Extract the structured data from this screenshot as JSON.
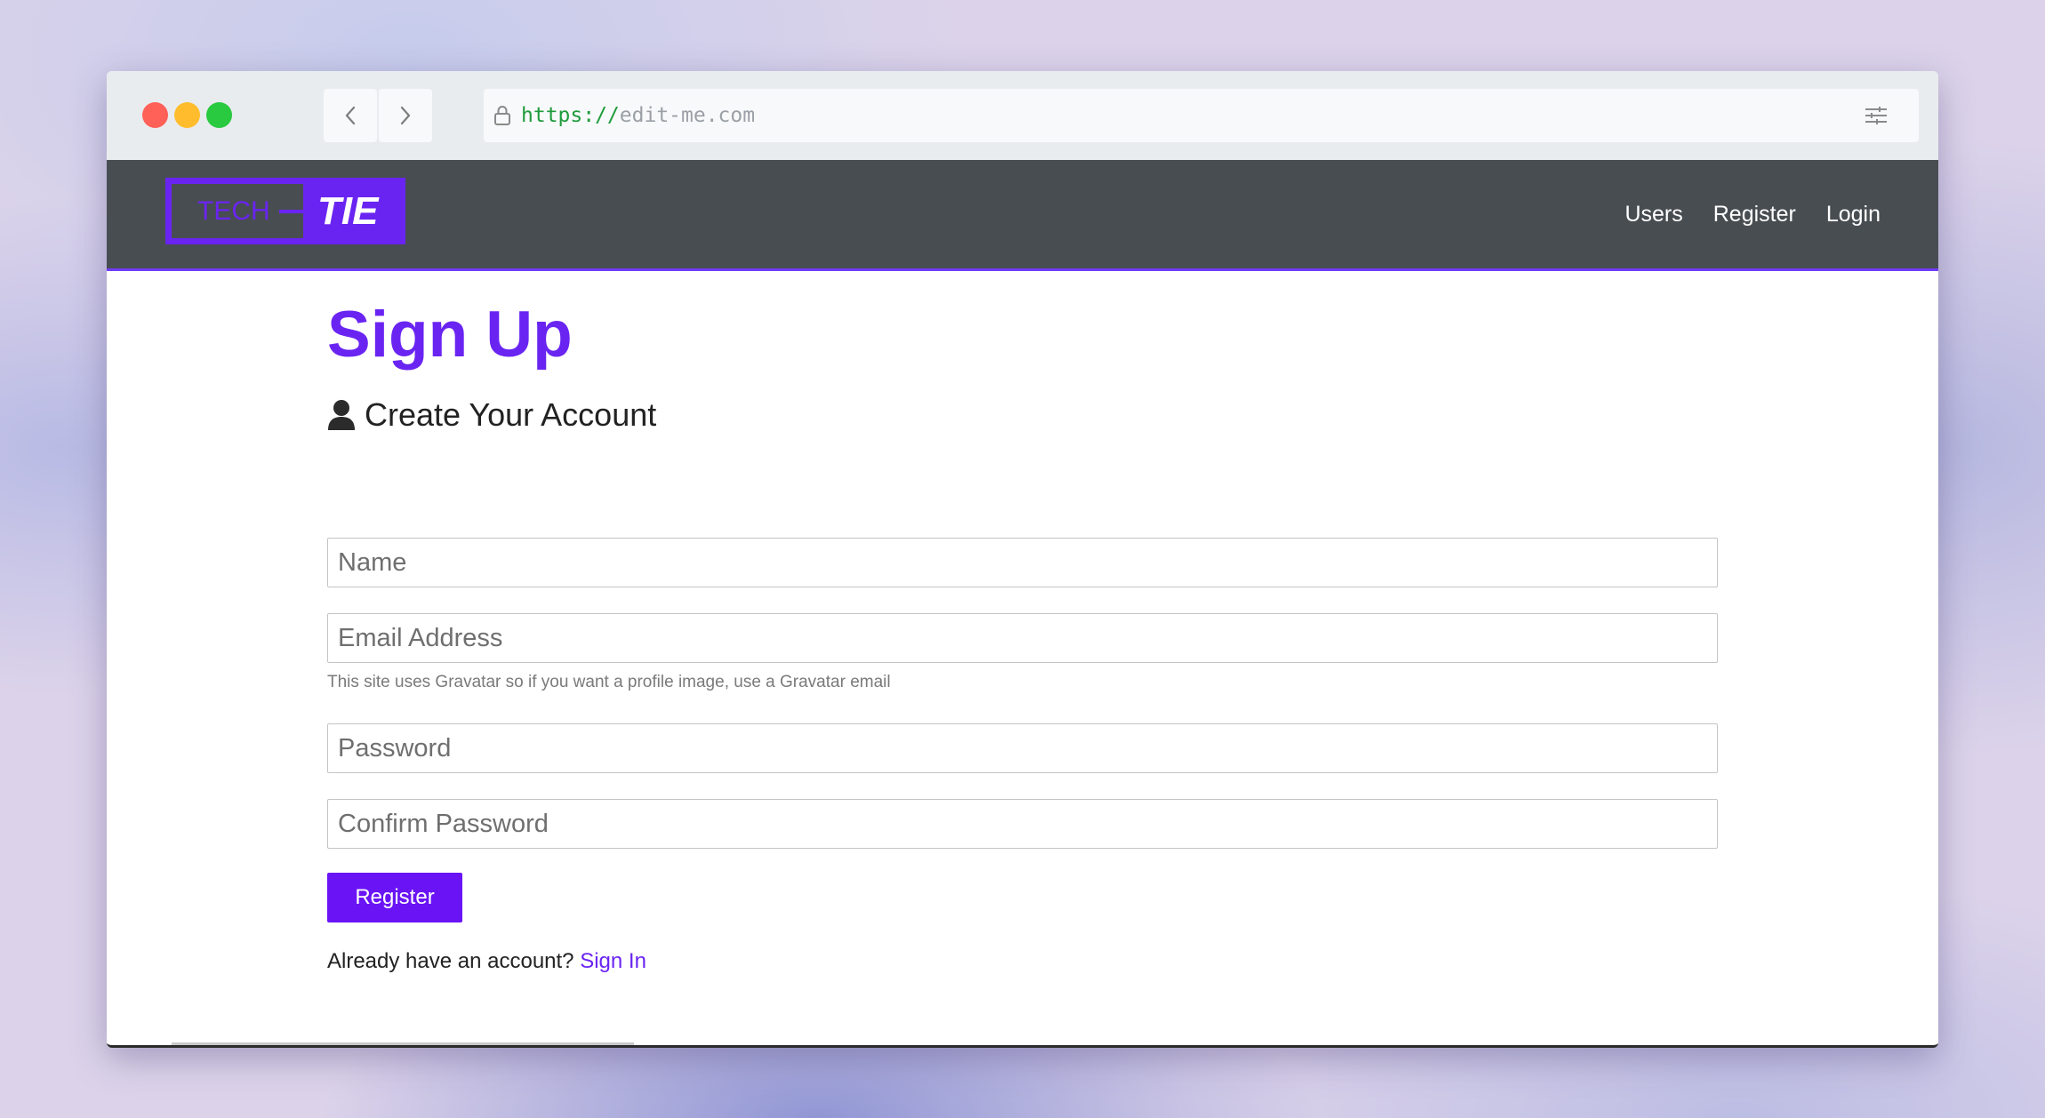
{
  "browser": {
    "url_scheme": "https://",
    "url_host": "edit-me.com"
  },
  "navbar": {
    "logo_left": "TECH",
    "logo_right": "TIE",
    "links": [
      "Users",
      "Register",
      "Login"
    ]
  },
  "main": {
    "title": "Sign Up",
    "lead": "Create Your Account",
    "fields": {
      "name_placeholder": "Name",
      "email_placeholder": "Email Address",
      "password_placeholder": "Password",
      "confirm_placeholder": "Confirm Password"
    },
    "email_help": "This site uses Gravatar so if you want a profile image, use a Gravatar email",
    "submit_label": "Register",
    "signin_prompt": "Already have an account?",
    "signin_link": "Sign In"
  },
  "icons": {
    "lock": "lock-icon",
    "back": "chevron-left-icon",
    "forward": "chevron-right-icon",
    "settings": "sliders-icon",
    "user": "user-icon"
  },
  "colors": {
    "accent": "#6a14f5",
    "navbar": "#484d52",
    "url_scheme": "#1e9b3b"
  }
}
